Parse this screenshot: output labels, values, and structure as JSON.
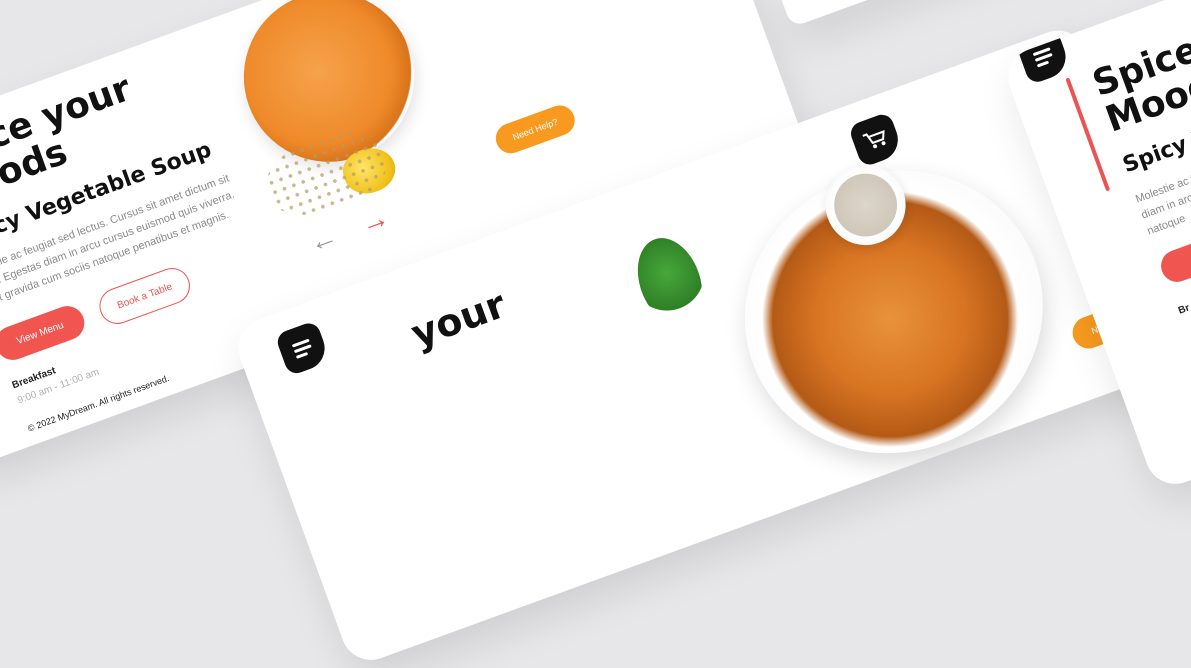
{
  "brand_color": "#f0554f",
  "help_color": "#f79a1f",
  "hero": {
    "headline_line1": "Spice your",
    "headline_line2": "Moods",
    "subtitle": "Spicy Vegetable Soup",
    "description": "Molestie ac feugiat sed lectus. Cursus sit amet dictum sit amet. Egestas diam in arcu cursus euismod quis viverra. Eget gravida cum sociis natoque penatibus et magnis.",
    "view_menu": "View Menu",
    "book_table": "Book a Table",
    "meal_label": "Breakfast",
    "meal_hours": "9:00 am - 11:00 am",
    "copyright": "© 2022 MyDream. All rights reserved.",
    "need_help": "Need Help?"
  },
  "center": {
    "headline_fragment": "your",
    "need_help": "Need Help?",
    "cart_icon": "cart-icon",
    "menu_icon": "menu-icon"
  },
  "right": {
    "headline_line1": "Spice your",
    "headline_line2": "Moods",
    "subtitle": "Spicy Vege",
    "description": "Molestie ac feugia Egestas diam in arc cum sociis natoque",
    "meal_fragment": "Br"
  }
}
